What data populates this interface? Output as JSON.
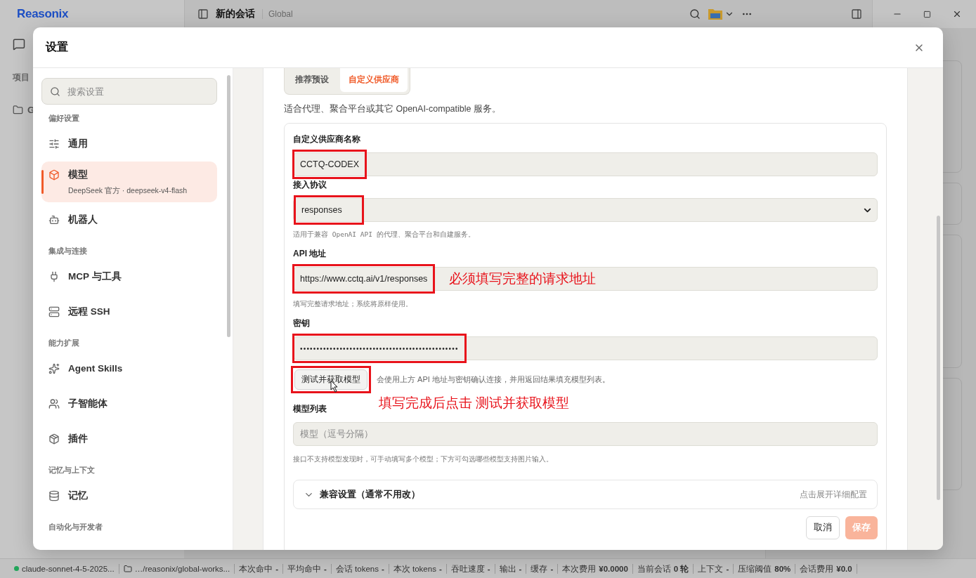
{
  "app": {
    "logo": "Reasonix",
    "sidebar_heading": "项目",
    "folder": "G",
    "conversation_title": "新的会话",
    "workspace": "Global"
  },
  "settings": {
    "title": "设置",
    "search": {
      "placeholder": "搜索设置"
    },
    "nav": [
      {
        "heading": "偏好设置",
        "items": [
          {
            "label": "通用",
            "selected": false
          },
          {
            "label": "模型",
            "subtitle": "DeepSeek 官方 · deepseek-v4-flash",
            "selected": true
          },
          {
            "label": "机器人",
            "selected": false
          }
        ]
      },
      {
        "heading": "集成与连接",
        "items": [
          {
            "label": "MCP 与工具",
            "selected": false
          },
          {
            "label": "远程 SSH",
            "selected": false
          }
        ]
      },
      {
        "heading": "能力扩展",
        "items": [
          {
            "label": "Agent Skills",
            "selected": false
          },
          {
            "label": "子智能体",
            "selected": false
          },
          {
            "label": "插件",
            "selected": false
          }
        ]
      },
      {
        "heading": "记忆与上下文",
        "items": [
          {
            "label": "记忆",
            "selected": false
          }
        ]
      },
      {
        "heading": "自动化与开发者"
      }
    ],
    "provider_tabs": [
      {
        "label": "推荐预设",
        "selected": false
      },
      {
        "label": "自定义供应商",
        "selected": true
      }
    ],
    "description": "适合代理、聚合平台或其它 OpenAI-compatible 服务。",
    "fields": [
      {
        "kind": "text",
        "label": "自定义供应商名称",
        "value": "CCTQ-CODEX",
        "annotated": true
      },
      {
        "kind": "select",
        "label": "接入协议",
        "value": "responses",
        "hint": "适用于兼容 OpenAI API 的代理、聚合平台和自建服务。",
        "annotated": true
      },
      {
        "kind": "text",
        "label": "API 地址",
        "value": "https://www.cctq.ai/v1/responses",
        "hint": "填写完整请求地址；系统将原样使用。",
        "annotated": true,
        "note": "必须填写完整的请求地址"
      },
      {
        "kind": "password",
        "label": "密钥",
        "value": "••••••••••••••••••••••••••••••••••••••••••••••••",
        "annotated": true
      },
      {
        "kind": "action",
        "button": "测试并获取模型",
        "hint": "会使用上方 API 地址与密钥确认连接，并用返回结果填充模型列表。",
        "annotated": true,
        "note": "填写完成后点击 测试并获取模型"
      },
      {
        "kind": "text",
        "label": "模型列表",
        "placeholder": "模型（逗号分隔）",
        "hint": "接口不支持模型发现时，可手动填写多个模型；下方可勾选哪些模型支持图片输入。",
        "annotated": false
      }
    ],
    "compat": {
      "title": "兼容设置（通常不用改）",
      "hint": "点击展开详细配置",
      "expanded": false
    },
    "actions": [
      {
        "label": "取消",
        "kind": "secondary",
        "disabled": false
      },
      {
        "label": "保存",
        "kind": "primary",
        "disabled": true
      }
    ]
  },
  "status_bar": {
    "model": {
      "label": "claude-sonnet-4-5-2025...",
      "color": "#22a55a"
    },
    "path": "…/reasonix/global-works...",
    "stats": [
      {
        "label": "本次命中",
        "value": "-"
      },
      {
        "label": "平均命中",
        "value": "-"
      },
      {
        "label": "会话 tokens",
        "value": "-"
      },
      {
        "label": "本次 tokens",
        "value": "-"
      },
      {
        "label": "吞吐速度",
        "value": "-"
      },
      {
        "label": "输出",
        "value": "-"
      },
      {
        "label": "缓存",
        "value": "-"
      },
      {
        "label": "本次费用",
        "value": "¥0.0000"
      },
      {
        "label": "当前会话",
        "value": "0 轮"
      },
      {
        "label": "上下文",
        "value": "-"
      },
      {
        "label": "压缩阈值",
        "value": "80%"
      },
      {
        "label": "会话费用",
        "value": "¥0.0"
      }
    ]
  }
}
